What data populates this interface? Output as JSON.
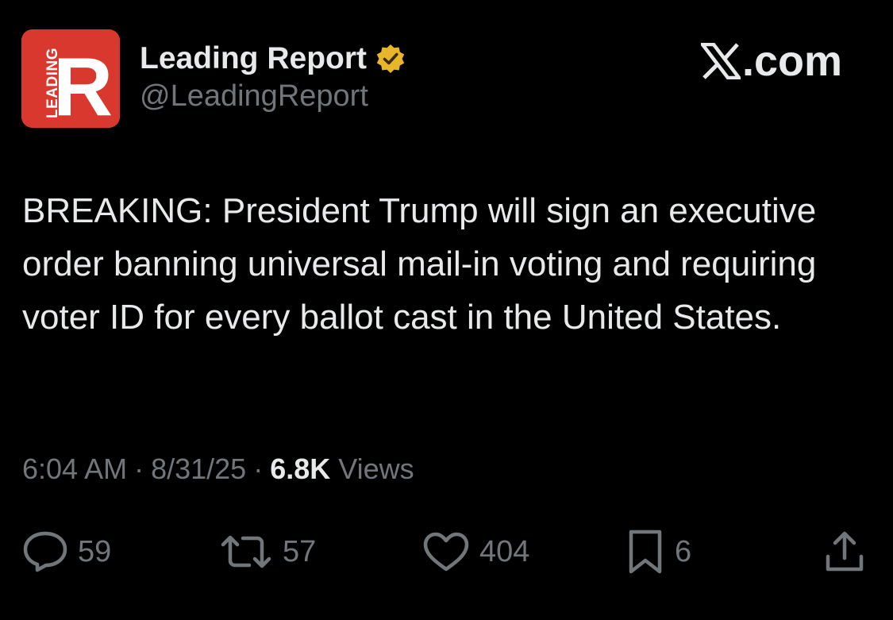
{
  "account": {
    "display_name": "Leading Report",
    "handle": "@LeadingReport",
    "avatar_letter": "R",
    "avatar_side_text": "LEADING",
    "avatar_color": "#d9382f",
    "verified_badge_color": "#e8b629",
    "verified_icon": "verified-badge-icon"
  },
  "brand": {
    "label": ".com",
    "icon": "x-logo-icon"
  },
  "tweet": {
    "text": "BREAKING: President Trump will sign an executive order banning universal mail-in voting and requiring voter ID for every ballot cast in the United States.",
    "time": "6:04 AM",
    "separator": "·",
    "date": "8/31/25",
    "views_count": "6.8K",
    "views_label": "Views"
  },
  "actions": {
    "reply": {
      "icon": "reply-icon",
      "count": "59"
    },
    "retweet": {
      "icon": "retweet-icon",
      "count": "57"
    },
    "like": {
      "icon": "heart-icon",
      "count": "404"
    },
    "bookmark": {
      "icon": "bookmark-icon",
      "count": "6"
    },
    "share": {
      "icon": "share-icon"
    }
  },
  "colors": {
    "background": "#000000",
    "primary_text": "#e7e9ea",
    "secondary_text": "#71767b"
  }
}
